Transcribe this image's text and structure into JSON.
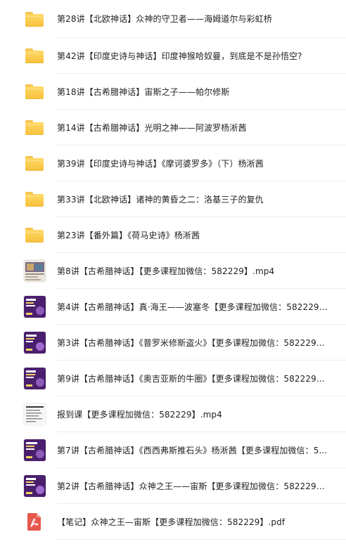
{
  "file_list": {
    "items": [
      {
        "type": "folder",
        "icon": "folder-icon",
        "name": "第28讲【北欧神话】众神的守卫者——海姆道尔与彩虹桥"
      },
      {
        "type": "folder",
        "icon": "folder-icon",
        "name": "第42讲【印度史诗与神话】印度神猴哈奴曼，到底是不是孙悟空?"
      },
      {
        "type": "folder",
        "icon": "folder-icon",
        "name": "第18讲【古希腊神话】宙斯之子——帕尔修斯"
      },
      {
        "type": "folder",
        "icon": "folder-icon",
        "name": "第14讲【古希腊神话】光明之神——阿波罗杨淅茜"
      },
      {
        "type": "folder",
        "icon": "folder-icon",
        "name": "第39讲【印度史诗与神话】《摩诃婆罗多》（下）杨淅茜"
      },
      {
        "type": "folder",
        "icon": "folder-icon",
        "name": "第33讲【北欧神话】诸神的黄昏之二：洛基三子的复仇"
      },
      {
        "type": "folder",
        "icon": "folder-icon",
        "name": "第23讲【番外篇】《荷马史诗》杨淅茜"
      },
      {
        "type": "video",
        "icon": "video-thumbnail-icon",
        "thumb": "photo",
        "name": "第8讲【古希腊神话】【更多课程加微信：582229】.mp4"
      },
      {
        "type": "video",
        "icon": "video-thumbnail-icon",
        "thumb": "purple",
        "name": "第4讲【古希腊神话】真·海王——波塞冬【更多课程加微信：582229】...."
      },
      {
        "type": "video",
        "icon": "video-thumbnail-icon",
        "thumb": "purple",
        "name": "第3讲【古希腊神话】《普罗米修斯盗火》【更多课程加微信：582229..."
      },
      {
        "type": "video",
        "icon": "video-thumbnail-icon",
        "thumb": "purple",
        "name": "第9讲【古希腊神话】《奥吉亚斯的牛圈》【更多课程加微信：582229..."
      },
      {
        "type": "video",
        "icon": "video-thumbnail-icon",
        "thumb": "doc",
        "name": "报到课【更多课程加微信：582229】.mp4"
      },
      {
        "type": "video",
        "icon": "video-thumbnail-icon",
        "thumb": "purple",
        "name": "第7讲【古希腊神话】《西西弗斯推石头》杨淅茜【更多课程加微信：5..."
      },
      {
        "type": "video",
        "icon": "video-thumbnail-icon",
        "thumb": "purple",
        "name": "第2讲【古希腊神话】众神之王——宙斯【更多课程加微信：582229】...."
      },
      {
        "type": "pdf",
        "icon": "pdf-icon",
        "name": "【笔记】众神之王—宙斯【更多课程加微信：582229】.pdf"
      }
    ]
  },
  "colors": {
    "folder": "#f7c03b",
    "thumb_purple": "#4a1f6e",
    "pdf_red": "#e8574d",
    "divider": "#ededed",
    "text": "#1f1f1f"
  }
}
